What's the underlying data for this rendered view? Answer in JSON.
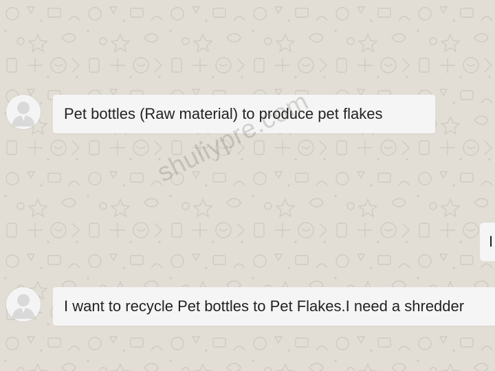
{
  "conversation": {
    "messages": [
      {
        "direction": "incoming",
        "text": "Pet bottles (Raw material) to produce pet flakes"
      },
      {
        "direction": "outgoing",
        "text": "I"
      },
      {
        "direction": "incoming",
        "text": "I want to recycle Pet bottles to Pet Flakes.I need a shredder"
      }
    ]
  },
  "watermark": {
    "text": "shuliypre.com"
  },
  "colors": {
    "background": "#e2ded6",
    "bubble": "#f5f5f5",
    "text": "#222222",
    "avatar_bg": "#f4f4f4",
    "avatar_figure": "#d9d9d9"
  },
  "icons": {
    "avatar": "default-user-avatar-icon",
    "wallpaper": "chat-doodle-pattern"
  }
}
